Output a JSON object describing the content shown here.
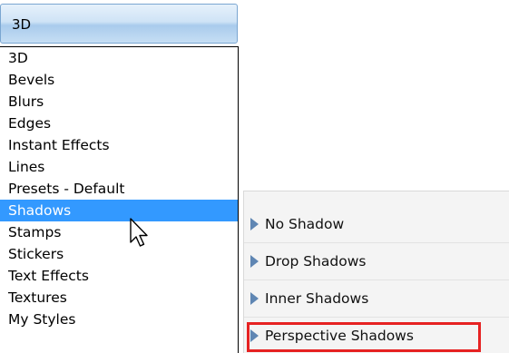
{
  "combo": {
    "value": "3D"
  },
  "list": {
    "items": [
      {
        "label": "3D",
        "selected": false
      },
      {
        "label": "Bevels",
        "selected": false
      },
      {
        "label": "Blurs",
        "selected": false
      },
      {
        "label": "Edges",
        "selected": false
      },
      {
        "label": "Instant Effects",
        "selected": false
      },
      {
        "label": "Lines",
        "selected": false
      },
      {
        "label": "Presets - Default",
        "selected": false
      },
      {
        "label": "Shadows",
        "selected": true
      },
      {
        "label": "Stamps",
        "selected": false
      },
      {
        "label": "Stickers",
        "selected": false
      },
      {
        "label": "Text Effects",
        "selected": false
      },
      {
        "label": "Textures",
        "selected": false
      },
      {
        "label": "My Styles",
        "selected": false
      }
    ],
    "selected_color": "#3399ff"
  },
  "shadow_panel": {
    "items": [
      {
        "label": "No Shadow",
        "highlighted": false
      },
      {
        "label": "Drop Shadows",
        "highlighted": false
      },
      {
        "label": "Inner Shadows",
        "highlighted": false
      },
      {
        "label": "Perspective Shadows",
        "highlighted": true
      }
    ],
    "arrow_icon": "triangle-right-icon",
    "highlight_color": "#e62222"
  },
  "cursor": {
    "icon": "arrow-pointer-icon"
  }
}
